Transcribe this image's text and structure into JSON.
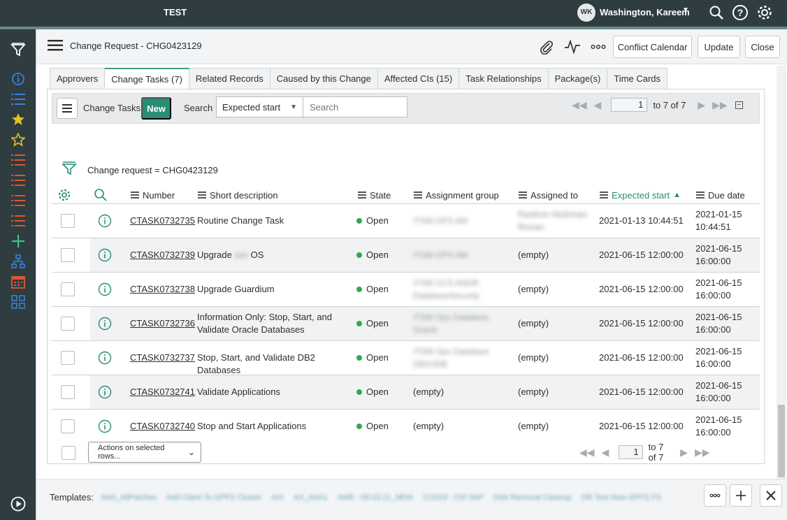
{
  "topbar": {
    "instance": "TEST",
    "avatar_initials": "WK",
    "user_name": "Washington, Kareem"
  },
  "form": {
    "title": "Change Request - CHG0423129",
    "buttons": {
      "conflict_calendar": "Conflict Calendar",
      "update": "Update",
      "close": "Close"
    }
  },
  "tabs": [
    {
      "label": "Approvers"
    },
    {
      "label": "Change Tasks (7)"
    },
    {
      "label": "Related Records"
    },
    {
      "label": "Caused by this Change"
    },
    {
      "label": "Affected CIs (15)"
    },
    {
      "label": "Task Relationships"
    },
    {
      "label": "Package(s)"
    },
    {
      "label": "Time Cards"
    }
  ],
  "list": {
    "title": "Change Tasks",
    "new_label": "New",
    "search_label": "Search",
    "search_field": "Expected start",
    "search_placeholder": "Search",
    "page": "1",
    "page_range": "to 7 of 7",
    "filter": "Change request = CHG0423129",
    "columns": {
      "number": "Number",
      "short_description": "Short description",
      "state": "State",
      "assignment_group": "Assignment group",
      "assigned_to": "Assigned to",
      "expected_start": "Expected start",
      "due_date": "Due date"
    },
    "rows": [
      {
        "number": "CTASK0732735",
        "desc1": "Routine Change Task",
        "desc2": "",
        "state": "Open",
        "group1": "ITSM OPS AM",
        "group2": "",
        "assigned1": "Rashon Hickman",
        "assigned2": "Roxan",
        "expected": "2021-01-13 10:44:51",
        "due1": "2021-01-15",
        "due2": "10:44:51"
      },
      {
        "number": "CTASK0732739",
        "desc1": "Upgrade",
        "desc_hidden": "xxx",
        "desc_after": "OS",
        "state": "Open",
        "group1": "ITSM OPS AM",
        "group2": "",
        "assigned1": "(empty)",
        "assigned2": "",
        "expected": "2021-06-15 12:00:00",
        "due1": "2021-06-15",
        "due2": "16:00:00"
      },
      {
        "number": "CTASK0732738",
        "desc1": "Upgrade Guardium",
        "desc2": "",
        "state": "Open",
        "group1": "ITSM CCS ANDR",
        "group2": "DatabaseSecurity",
        "assigned1": "(empty)",
        "assigned2": "",
        "expected": "2021-06-15 12:00:00",
        "due1": "2021-06-15",
        "due2": "16:00:00"
      },
      {
        "number": "CTASK0732736",
        "desc1": "Information Only: Stop, Start, and",
        "desc2": "Validate Oracle Databases",
        "state": "Open",
        "group1": "ITSM Ops Database",
        "group2": "Oracle",
        "assigned1": "(empty)",
        "assigned2": "",
        "expected": "2021-06-15 12:00:00",
        "due1": "2021-06-15",
        "due2": "16:00:00"
      },
      {
        "number": "CTASK0732737",
        "desc1": "Stop, Start, and Validate DB2 Databases",
        "desc2": "",
        "state": "Open",
        "group1": "ITSM Ops Database",
        "group2": "DB2UDB",
        "assigned1": "(empty)",
        "assigned2": "",
        "expected": "2021-06-15 12:00:00",
        "due1": "2021-06-15",
        "due2": "16:00:00"
      },
      {
        "number": "CTASK0732741",
        "desc1": "Validate Applications",
        "desc2": "",
        "state": "Open",
        "group1": "(empty)",
        "group2": "",
        "assigned1": "(empty)",
        "assigned2": "",
        "expected": "2021-06-15 12:00:00",
        "due1": "2021-06-15",
        "due2": "16:00:00"
      },
      {
        "number": "CTASK0732740",
        "desc1": "Stop and Start Applications",
        "desc2": "",
        "state": "Open",
        "group1": "(empty)",
        "group2": "",
        "assigned1": "(empty)",
        "assigned2": "",
        "expected": "2021-06-15 12:00:00",
        "due1": "2021-06-15",
        "due2": "16:00:00"
      }
    ],
    "actions_label": "Actions on selected rows...",
    "footer_page": "1",
    "footer_range": "to 7 of 7"
  },
  "templates": {
    "label": "Templates:",
    "items": [
      "AAA_AllPatches",
      "Add Client To GPFS Cluster",
      "AIX",
      "AX_AAA1",
      "AME - 09.03.21_NEW",
      "CO203 - Ctrl SAP",
      "Disk Removal Cleanup",
      "DR Test New GPFS FS"
    ]
  },
  "colors": {
    "topbar": "#2f3c40",
    "accent": "#278d74",
    "open_state": "#32a852"
  }
}
